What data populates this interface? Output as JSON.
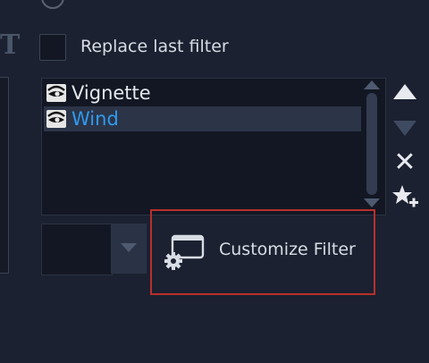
{
  "options": {
    "replace_last_filter_label": "Replace last filter",
    "replace_last_filter_checked": false
  },
  "filter_list": {
    "items": [
      {
        "label": "Vignette",
        "icon": "eye-icon",
        "selected": false
      },
      {
        "label": "Wind",
        "icon": "eye-icon",
        "selected": true
      }
    ]
  },
  "side_buttons": {
    "move_up": "triangle-up-icon",
    "move_down": "triangle-down-icon",
    "delete": "x-icon",
    "delete_glyph": "✕",
    "add_favorite": "star-add-icon"
  },
  "customize": {
    "label": "Customize Filter",
    "icon": "window-gear-icon"
  },
  "colors": {
    "background": "#1b2130",
    "selected_text": "#2e9bef",
    "highlight_frame": "#b8302a"
  }
}
